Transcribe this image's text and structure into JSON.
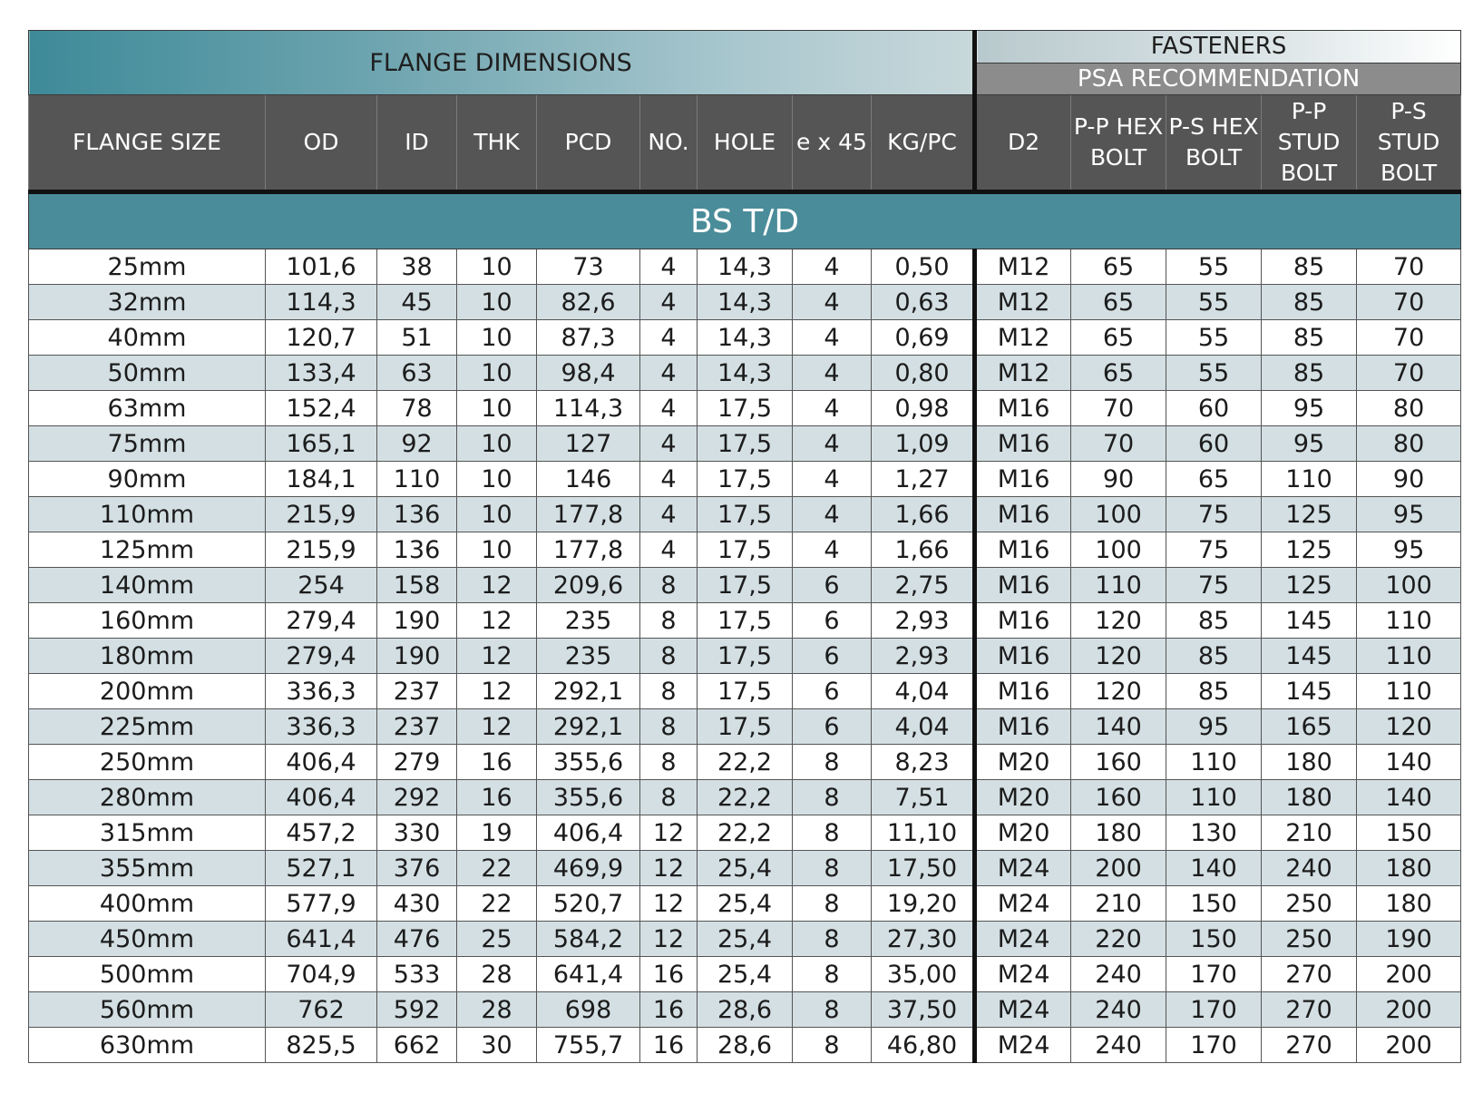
{
  "header": {
    "flange_dimensions": "FLANGE DIMENSIONS",
    "fasteners": "FASTENERS",
    "psa_recommendation": "PSA RECOMMENDATION"
  },
  "columns": {
    "flange_size": "FLANGE SIZE",
    "od": "OD",
    "id": "ID",
    "thk": "THK",
    "pcd": "PCD",
    "no": "NO.",
    "hole": "HOLE",
    "e45": "e x 45",
    "kgpc": "KG/PC",
    "d2": "D2",
    "pp_hex": "P-P HEX BOLT",
    "ps_hex": "P-S HEX BOLT",
    "pp_stud": "P-P STUD BOLT",
    "ps_stud": "P-S STUD BOLT"
  },
  "section_title": "BS T/D",
  "rows": [
    [
      "25mm",
      "101,6",
      "38",
      "10",
      "73",
      "4",
      "14,3",
      "4",
      "0,50",
      "M12",
      "65",
      "55",
      "85",
      "70"
    ],
    [
      "32mm",
      "114,3",
      "45",
      "10",
      "82,6",
      "4",
      "14,3",
      "4",
      "0,63",
      "M12",
      "65",
      "55",
      "85",
      "70"
    ],
    [
      "40mm",
      "120,7",
      "51",
      "10",
      "87,3",
      "4",
      "14,3",
      "4",
      "0,69",
      "M12",
      "65",
      "55",
      "85",
      "70"
    ],
    [
      "50mm",
      "133,4",
      "63",
      "10",
      "98,4",
      "4",
      "14,3",
      "4",
      "0,80",
      "M12",
      "65",
      "55",
      "85",
      "70"
    ],
    [
      "63mm",
      "152,4",
      "78",
      "10",
      "114,3",
      "4",
      "17,5",
      "4",
      "0,98",
      "M16",
      "70",
      "60",
      "95",
      "80"
    ],
    [
      "75mm",
      "165,1",
      "92",
      "10",
      "127",
      "4",
      "17,5",
      "4",
      "1,09",
      "M16",
      "70",
      "60",
      "95",
      "80"
    ],
    [
      "90mm",
      "184,1",
      "110",
      "10",
      "146",
      "4",
      "17,5",
      "4",
      "1,27",
      "M16",
      "90",
      "65",
      "110",
      "90"
    ],
    [
      "110mm",
      "215,9",
      "136",
      "10",
      "177,8",
      "4",
      "17,5",
      "4",
      "1,66",
      "M16",
      "100",
      "75",
      "125",
      "95"
    ],
    [
      "125mm",
      "215,9",
      "136",
      "10",
      "177,8",
      "4",
      "17,5",
      "4",
      "1,66",
      "M16",
      "100",
      "75",
      "125",
      "95"
    ],
    [
      "140mm",
      "254",
      "158",
      "12",
      "209,6",
      "8",
      "17,5",
      "6",
      "2,75",
      "M16",
      "110",
      "75",
      "125",
      "100"
    ],
    [
      "160mm",
      "279,4",
      "190",
      "12",
      "235",
      "8",
      "17,5",
      "6",
      "2,93",
      "M16",
      "120",
      "85",
      "145",
      "110"
    ],
    [
      "180mm",
      "279,4",
      "190",
      "12",
      "235",
      "8",
      "17,5",
      "6",
      "2,93",
      "M16",
      "120",
      "85",
      "145",
      "110"
    ],
    [
      "200mm",
      "336,3",
      "237",
      "12",
      "292,1",
      "8",
      "17,5",
      "6",
      "4,04",
      "M16",
      "120",
      "85",
      "145",
      "110"
    ],
    [
      "225mm",
      "336,3",
      "237",
      "12",
      "292,1",
      "8",
      "17,5",
      "6",
      "4,04",
      "M16",
      "140",
      "95",
      "165",
      "120"
    ],
    [
      "250mm",
      "406,4",
      "279",
      "16",
      "355,6",
      "8",
      "22,2",
      "8",
      "8,23",
      "M20",
      "160",
      "110",
      "180",
      "140"
    ],
    [
      "280mm",
      "406,4",
      "292",
      "16",
      "355,6",
      "8",
      "22,2",
      "8",
      "7,51",
      "M20",
      "160",
      "110",
      "180",
      "140"
    ],
    [
      "315mm",
      "457,2",
      "330",
      "19",
      "406,4",
      "12",
      "22,2",
      "8",
      "11,10",
      "M20",
      "180",
      "130",
      "210",
      "150"
    ],
    [
      "355mm",
      "527,1",
      "376",
      "22",
      "469,9",
      "12",
      "25,4",
      "8",
      "17,50",
      "M24",
      "200",
      "140",
      "240",
      "180"
    ],
    [
      "400mm",
      "577,9",
      "430",
      "22",
      "520,7",
      "12",
      "25,4",
      "8",
      "19,20",
      "M24",
      "210",
      "150",
      "250",
      "180"
    ],
    [
      "450mm",
      "641,4",
      "476",
      "25",
      "584,2",
      "12",
      "25,4",
      "8",
      "27,30",
      "M24",
      "220",
      "150",
      "250",
      "190"
    ],
    [
      "500mm",
      "704,9",
      "533",
      "28",
      "641,4",
      "16",
      "25,4",
      "8",
      "35,00",
      "M24",
      "240",
      "170",
      "270",
      "200"
    ],
    [
      "560mm",
      "762",
      "592",
      "28",
      "698",
      "16",
      "28,6",
      "8",
      "37,50",
      "M24",
      "240",
      "170",
      "270",
      "200"
    ],
    [
      "630mm",
      "825,5",
      "662",
      "30",
      "755,7",
      "16",
      "28,6",
      "8",
      "46,80",
      "M24",
      "240",
      "170",
      "270",
      "200"
    ]
  ]
}
